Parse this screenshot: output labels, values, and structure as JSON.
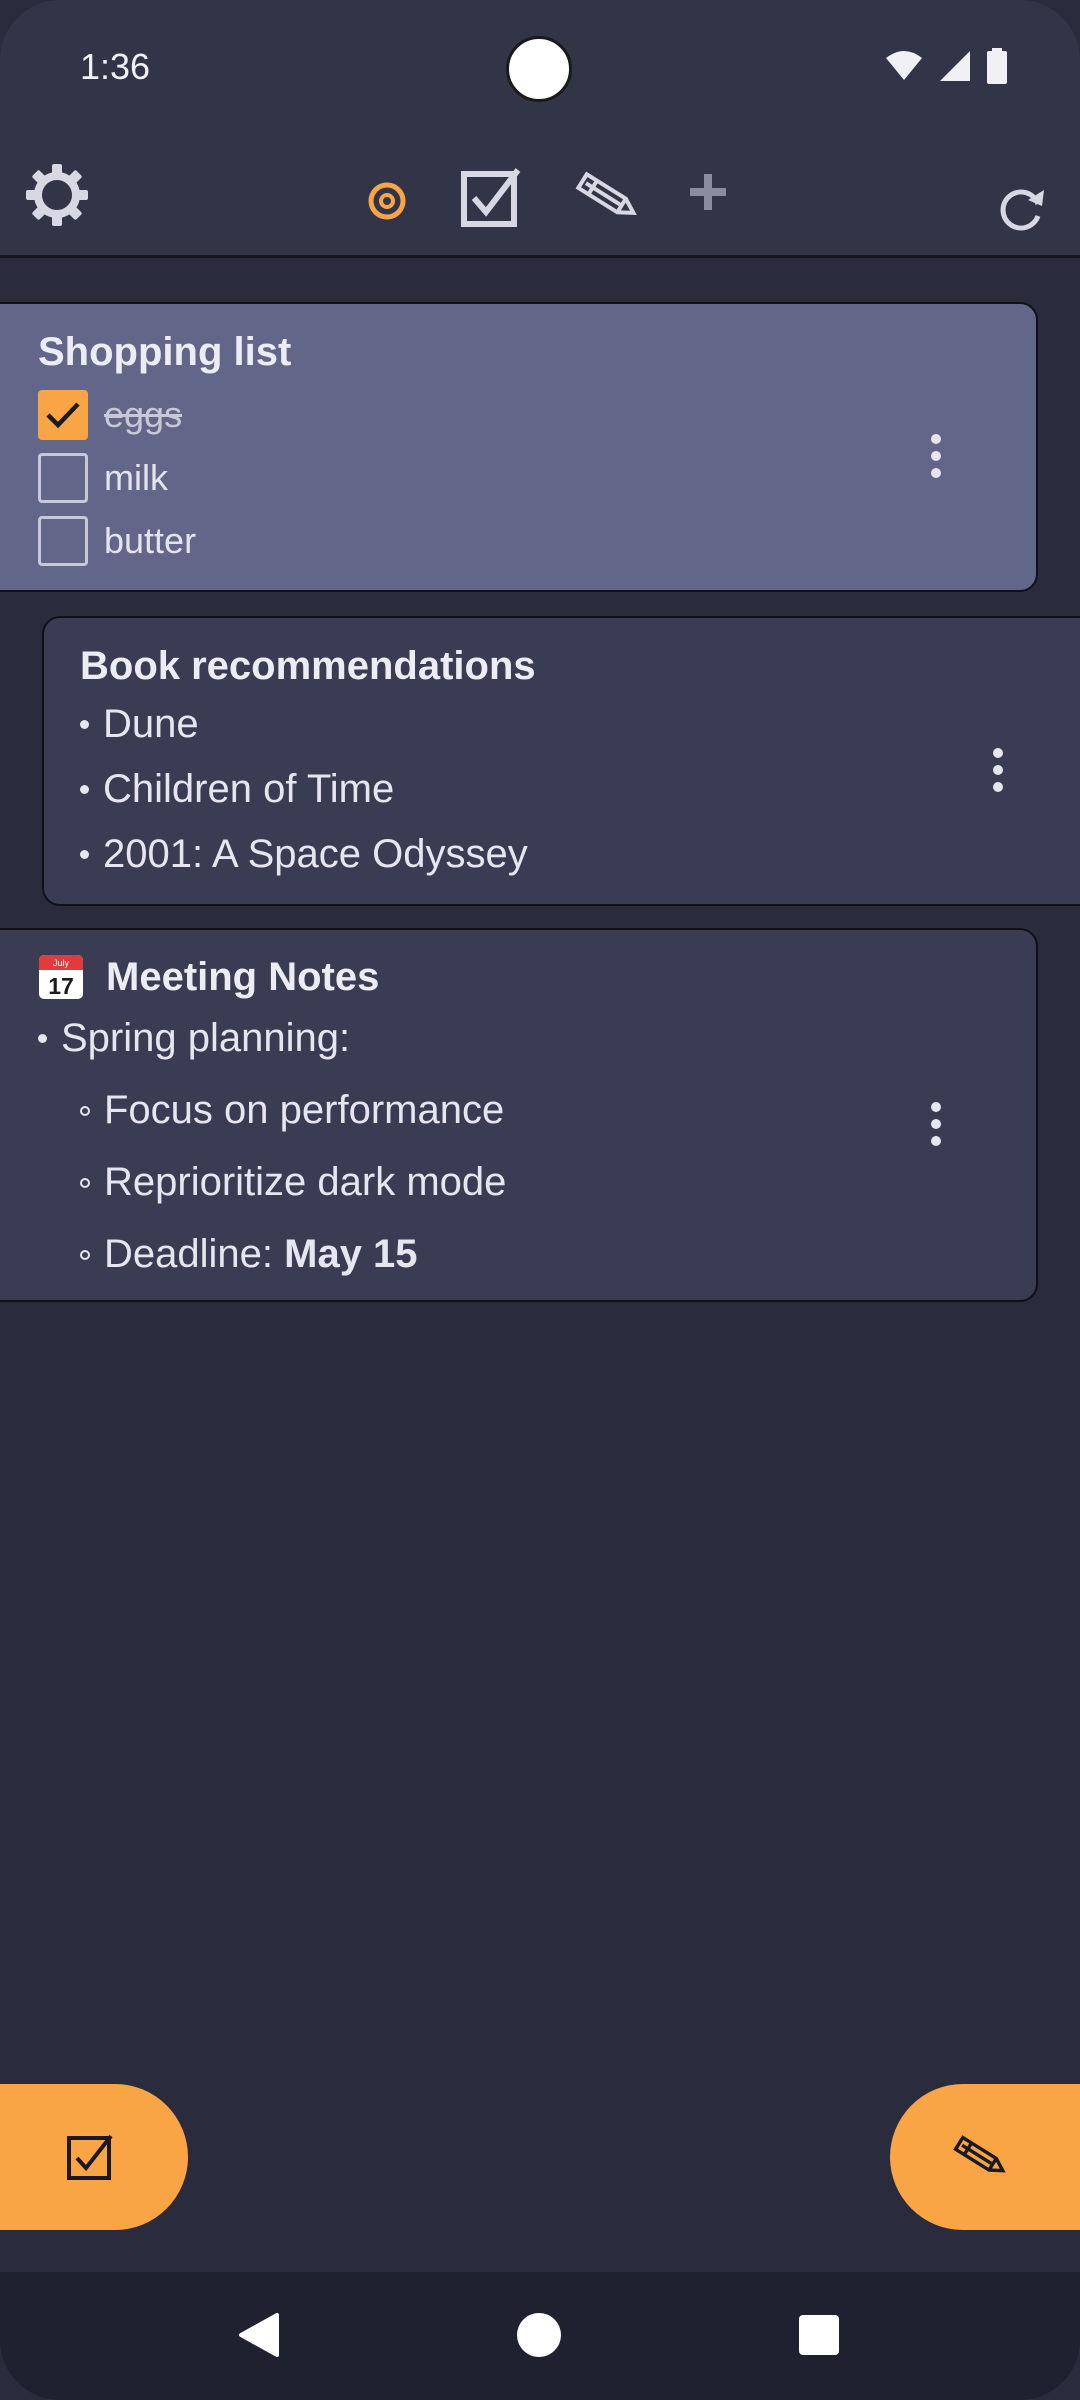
{
  "status_bar": {
    "time": "1:36",
    "icons": [
      "wifi-icon",
      "cell-signal-icon",
      "battery-icon"
    ]
  },
  "toolbar": {
    "settings_icon": "gear-icon",
    "filter_all_icon": "target-icon",
    "filter_checklists_icon": "checkbox-icon",
    "filter_notes_icon": "pencil-icon",
    "add_icon": "plus-icon",
    "sync_icon": "refresh-icon"
  },
  "notes": [
    {
      "title": "Shopping list",
      "type": "checklist",
      "items": [
        {
          "label": "eggs",
          "checked": true
        },
        {
          "label": "milk",
          "checked": false
        },
        {
          "label": "butter",
          "checked": false
        }
      ]
    },
    {
      "title": "Book recommendations",
      "type": "list",
      "items": [
        "Dune",
        "Children of Time",
        "2001: A Space Odyssey"
      ]
    },
    {
      "title": "Meeting Notes",
      "title_icon": "calendar-icon",
      "title_icon_month": "July",
      "title_icon_day": "17",
      "type": "note",
      "top_item": "Spring planning:",
      "sub_items": [
        "Focus on performance",
        "Reprioritize dark mode"
      ],
      "deadline_label": "Deadline: ",
      "deadline_value": "May 15"
    }
  ],
  "fabs": {
    "new_checklist_icon": "checkbox-icon",
    "new_note_icon": "pencil-icon"
  },
  "nav": {
    "back_icon": "back-triangle-icon",
    "home_icon": "home-circle-icon",
    "recents_icon": "recents-square-icon"
  },
  "colors": {
    "accent": "#f9a546",
    "background": "#2a2c3e",
    "toolbar": "#323447",
    "card_selected": "#626688",
    "card": "#3a3c53"
  }
}
